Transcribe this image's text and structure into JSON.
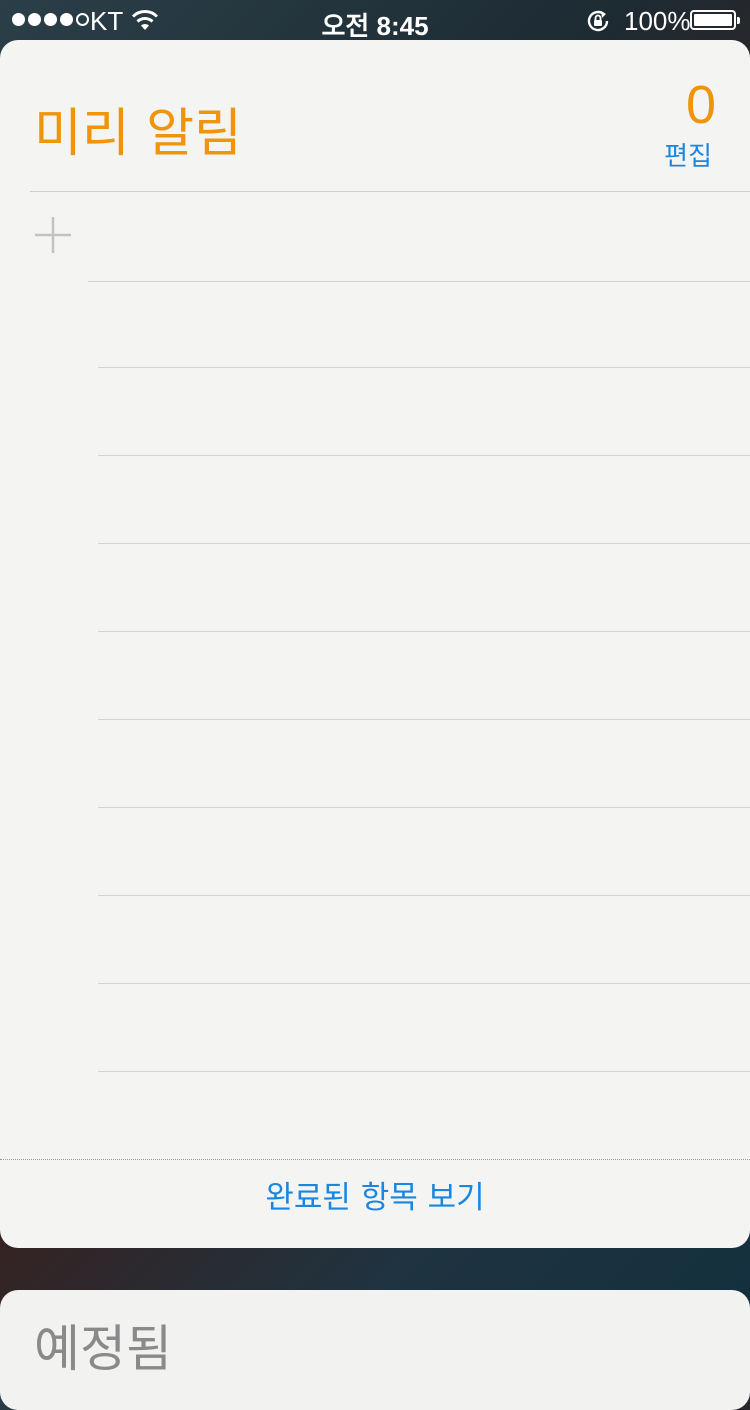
{
  "status_bar": {
    "carrier": "KT",
    "time": "오전 8:45",
    "battery_percent": "100%",
    "signal_bars_filled": 4,
    "signal_bars_total": 5
  },
  "reminders": {
    "title": "미리 알림",
    "count": "0",
    "edit_label": "편집",
    "show_completed_label": "완료된 항목 보기",
    "accent_color": "#f0940c",
    "link_color": "#1b86e0"
  },
  "next_widget": {
    "title": "예정됨"
  }
}
